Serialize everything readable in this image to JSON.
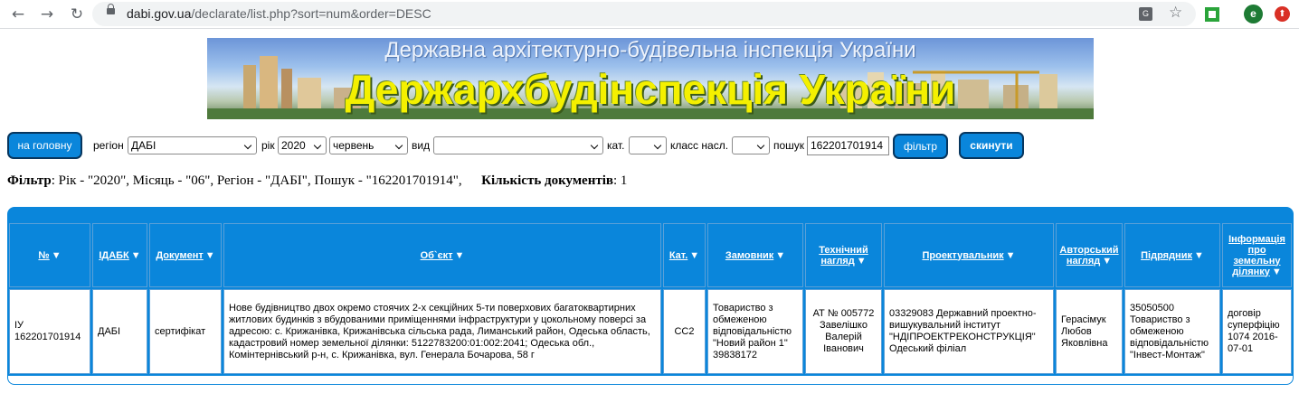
{
  "browser": {
    "url_host": "dabi.gov.ua",
    "url_path": "/declarate/list.php?sort=num&order=DESC",
    "profile_letter": "e"
  },
  "banner": {
    "subtitle": "Державна архітектурно-будівельна інспекція України",
    "title": "Держархбудінспекція України"
  },
  "toolbar": {
    "home_label": "на головну",
    "region_label": "регіон",
    "region_value": "ДАБІ",
    "year_label": "рік",
    "year_value": "2020",
    "month_value": "червень",
    "type_label": "вид",
    "type_value": "",
    "cat_label": "кат.",
    "cat_value": "",
    "class_label": "класс насл.",
    "class_value": "",
    "search_label": "пошук",
    "search_value": "162201701914",
    "filter_label": "фільтр",
    "reset_label": "скинути"
  },
  "filter_summary": {
    "prefix": "Фільтр",
    "text": ": Рік - \"2020\", Місяць - \"06\", Регіон - \"ДАБІ\", Пошук - \"162201701914\",",
    "count_label": "Кількість документів",
    "count_value": ": 1"
  },
  "table": {
    "headers": [
      {
        "label": "№",
        "sort": "▼"
      },
      {
        "label": "ІДАБК",
        "sort": "▼"
      },
      {
        "label": "Документ",
        "sort": "▼"
      },
      {
        "label": "Об`єкт",
        "sort": "▼"
      },
      {
        "label": "Кат.",
        "sort": "▼"
      },
      {
        "label": "Замовник",
        "sort": "▼"
      },
      {
        "label": "Технічний нагляд",
        "sort": "▼"
      },
      {
        "label": "Проектувальник",
        "sort": "▼"
      },
      {
        "label": "Авторський нагляд",
        "sort": "▼"
      },
      {
        "label": "Підрядник",
        "sort": "▼"
      },
      {
        "label": "Інформація про земельну ділянку",
        "sort": "▼"
      }
    ],
    "rows": [
      {
        "num": "ІУ 162201701914",
        "idabk": "ДАБІ",
        "document": "сертифікат",
        "object": "Нове будівництво двох окремо стоячих 2-х секційних 5-ти поверхових багатоквартирних житлових будинків з вбудованими приміщеннями інфраструктури у цокольному поверсі за адресою: с. Крижанівка, Крижанівська сільська рада, Лиманський район, Одеська область, кадастровий номер земельної ділянки: 5122783200:01:002:2041; Одеська обл., Комінтернівський р-н, с. Крижанівка, вул. Генерала Бочарова, 58 г",
        "category": "СС2",
        "customer": "Товариство з обмеженою відповідальністю \"Новий район 1\" 39838172",
        "tech_supervision": "АТ № 005772 Завелішко Валерій Іванович",
        "designer": "03329083 Державний проектно-вишукувальний інститут \"НДІПРОЕКТРЕКОНСТРУКЦІЯ\" Одеський філіал",
        "author_supervision": "Герасімук Любов Яковлівна",
        "contractor": "35050500 Товариство з обмеженою відповідальністю \"Інвест-Монтаж\"",
        "land_info": "договір суперфіцію 1074 2016-07-01"
      }
    ]
  }
}
